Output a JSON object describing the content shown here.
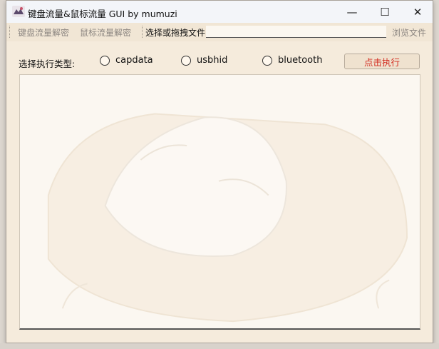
{
  "window": {
    "title": "键盘流量&鼠标流量 GUI by mumuzi",
    "controls": {
      "minimize": "—",
      "maximize": "☐",
      "close": "✕"
    }
  },
  "toolbar": {
    "keyboard_decode": "键盘流量解密",
    "mouse_decode": "鼠标流量解密",
    "file_label": "选择或拖拽文件",
    "file_value": "",
    "browse": "浏览文件"
  },
  "exec": {
    "label": "选择执行类型:",
    "options": [
      "capdata",
      "usbhid",
      "bluetooth"
    ],
    "selected": null,
    "run_button": "点击执行"
  },
  "output": {
    "text": ""
  },
  "colors": {
    "accent_red": "#d22a1e",
    "window_bg": "#f5ebdc"
  }
}
